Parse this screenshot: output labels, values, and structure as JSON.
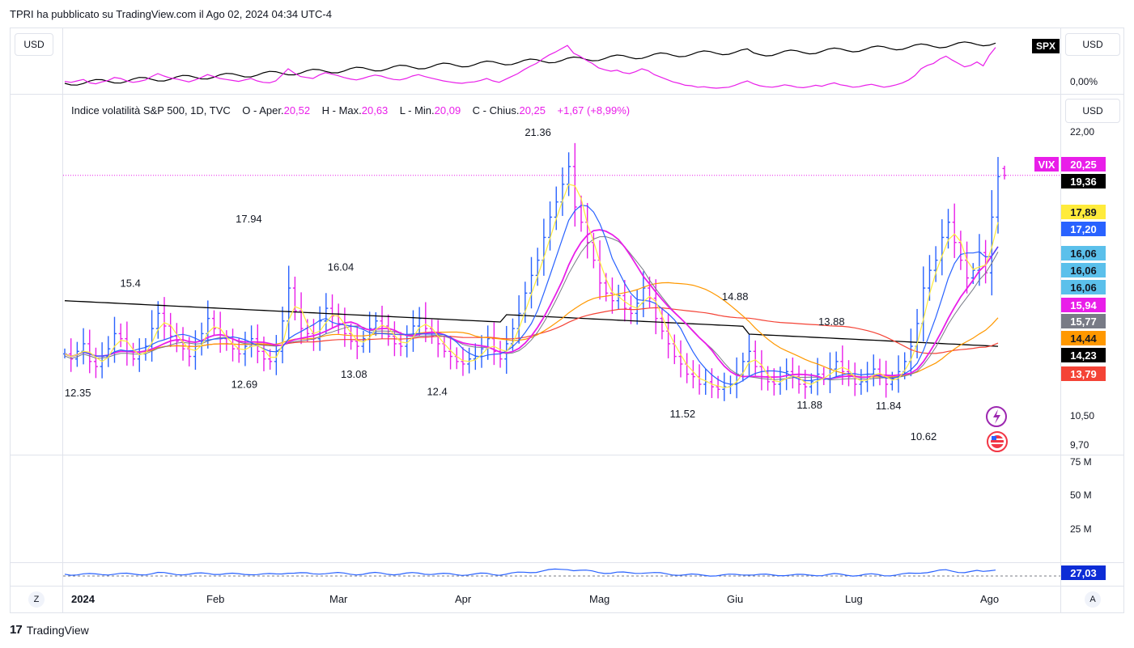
{
  "header": {
    "published_line": "TPRI ha pubblicato su TradingView.com il Ago 02, 2024 04:34 UTC-4"
  },
  "top_pane": {
    "currency_left": "USD",
    "currency_right": "USD",
    "compare_symbol": "SPX",
    "pct_label": "0,00%"
  },
  "main_pane": {
    "currency_right": "USD",
    "legend": {
      "name": "Indice volatilità S&P 500, 1D, TVC",
      "open_label": "O - Aper.",
      "open": "20,52",
      "high_label": "H - Max.",
      "high": "20,63",
      "low_label": "L - Min.",
      "low": "20,09",
      "close_label": "C - Chius.",
      "close": "20,25",
      "change": "+1,67 (+8,99%)"
    },
    "y_ticks": [
      "22,00",
      "10,50",
      "9,70"
    ],
    "symbol_badge": "VIX",
    "price_badges": [
      {
        "value": "20,25",
        "bg": "#e91ee9",
        "fg": "#ffffff"
      },
      {
        "value": "19,36",
        "bg": "#000000",
        "fg": "#ffffff"
      },
      {
        "value": "17,89",
        "bg": "#ffeb3b",
        "fg": "#131722"
      },
      {
        "value": "17,20",
        "bg": "#2962ff",
        "fg": "#ffffff"
      },
      {
        "value": "16,06",
        "bg": "#5bc0eb",
        "fg": "#131722"
      },
      {
        "value": "16,06",
        "bg": "#5bc0eb",
        "fg": "#131722"
      },
      {
        "value": "16,06",
        "bg": "#5bc0eb",
        "fg": "#131722"
      },
      {
        "value": "15,94",
        "bg": "#e91ee9",
        "fg": "#ffffff"
      },
      {
        "value": "15,77",
        "bg": "#787b86",
        "fg": "#ffffff"
      },
      {
        "value": "14,44",
        "bg": "#ff9800",
        "fg": "#131722"
      },
      {
        "value": "14,23",
        "bg": "#000000",
        "fg": "#ffffff"
      },
      {
        "value": "13,79",
        "bg": "#f44336",
        "fg": "#ffffff"
      }
    ]
  },
  "volume_pane": {
    "y_ticks": [
      "75 M",
      "50 M",
      "25 M"
    ]
  },
  "osc_pane": {
    "badge": "27,03"
  },
  "x_axis": {
    "labels": [
      "2024",
      "Feb",
      "Mar",
      "Apr",
      "Mag",
      "Giu",
      "Lug",
      "Ago"
    ],
    "left_button": "Z",
    "right_button": "A"
  },
  "footer": {
    "brand": "TradingView"
  },
  "chart_data": {
    "type": "ohlc",
    "title": "Indice volatilità S&P 500, 1D, TVC",
    "x_range": [
      "2024-01-02",
      "2024-08-02"
    ],
    "ylim": [
      9.7,
      22.0
    ],
    "annotated_points": [
      {
        "date": "2024-01-05",
        "value": 12.35,
        "kind": "low",
        "label": "12.35"
      },
      {
        "date": "2024-01-17",
        "value": 15.4,
        "kind": "high",
        "label": "15.4"
      },
      {
        "date": "2024-02-13",
        "value": 17.94,
        "kind": "high",
        "label": "17.94"
      },
      {
        "date": "2024-02-12",
        "value": 12.69,
        "kind": "low",
        "label": "12.69"
      },
      {
        "date": "2024-03-05",
        "value": 16.04,
        "kind": "high",
        "label": "16.04"
      },
      {
        "date": "2024-03-08",
        "value": 13.08,
        "kind": "low",
        "label": "13.08"
      },
      {
        "date": "2024-03-27",
        "value": 12.4,
        "kind": "low",
        "label": "12.4"
      },
      {
        "date": "2024-04-19",
        "value": 21.36,
        "kind": "high",
        "label": "21.36"
      },
      {
        "date": "2024-05-22",
        "value": 11.52,
        "kind": "low",
        "label": "11.52"
      },
      {
        "date": "2024-06-03",
        "value": 14.88,
        "kind": "high",
        "label": "14.88"
      },
      {
        "date": "2024-06-20",
        "value": 11.88,
        "kind": "low",
        "label": "11.88"
      },
      {
        "date": "2024-06-25",
        "value": 13.88,
        "kind": "high",
        "label": "13.88"
      },
      {
        "date": "2024-07-08",
        "value": 11.84,
        "kind": "low",
        "label": "11.84"
      },
      {
        "date": "2024-07-16",
        "value": 10.62,
        "kind": "low",
        "label": "10.62"
      }
    ],
    "last_bar": {
      "open": 20.52,
      "high": 20.63,
      "low": 20.09,
      "close": 20.25
    },
    "moving_average_last_values": [
      19.36,
      17.89,
      17.2,
      16.06,
      15.94,
      15.77,
      14.44,
      14.23,
      13.79
    ],
    "series_close": [
      13.2,
      13.0,
      13.3,
      13.6,
      12.9,
      12.7,
      13.1,
      13.4,
      14.0,
      13.8,
      13.3,
      13.0,
      13.2,
      13.5,
      14.2,
      14.8,
      14.3,
      13.9,
      13.7,
      13.4,
      13.1,
      13.5,
      14.0,
      14.6,
      14.2,
      13.8,
      13.6,
      13.4,
      13.2,
      13.5,
      13.8,
      13.3,
      13.0,
      12.9,
      13.3,
      14.5,
      15.8,
      14.9,
      14.2,
      14.0,
      13.8,
      14.5,
      15.0,
      14.7,
      14.4,
      14.0,
      13.7,
      13.5,
      13.8,
      14.2,
      14.5,
      14.3,
      13.9,
      13.6,
      13.5,
      13.8,
      14.3,
      14.6,
      14.2,
      13.9,
      13.6,
      13.3,
      13.1,
      12.9,
      12.8,
      13.0,
      13.1,
      13.4,
      13.8,
      13.3,
      13.0,
      13.6,
      14.2,
      14.8,
      15.6,
      16.3,
      16.9,
      17.8,
      18.6,
      19.2,
      19.9,
      20.6,
      19.0,
      18.4,
      17.6,
      16.9,
      16.0,
      15.6,
      15.3,
      15.5,
      15.0,
      14.8,
      15.2,
      15.8,
      15.4,
      14.6,
      14.1,
      13.6,
      13.1,
      12.8,
      12.4,
      12.3,
      12.0,
      12.1,
      11.9,
      11.8,
      11.9,
      12.0,
      12.4,
      12.9,
      13.3,
      12.7,
      12.3,
      12.1,
      12.0,
      12.2,
      12.5,
      12.3,
      12.0,
      11.9,
      12.1,
      12.4,
      12.2,
      12.6,
      12.9,
      12.5,
      12.3,
      12.0,
      12.1,
      12.4,
      12.6,
      12.3,
      12.0,
      12.2,
      12.5,
      12.9,
      13.5,
      14.4,
      15.8,
      16.5,
      16.9,
      17.8,
      18.4,
      17.6,
      16.9,
      16.2,
      16.5,
      17.2,
      16.4,
      18.6,
      20.2
    ]
  }
}
